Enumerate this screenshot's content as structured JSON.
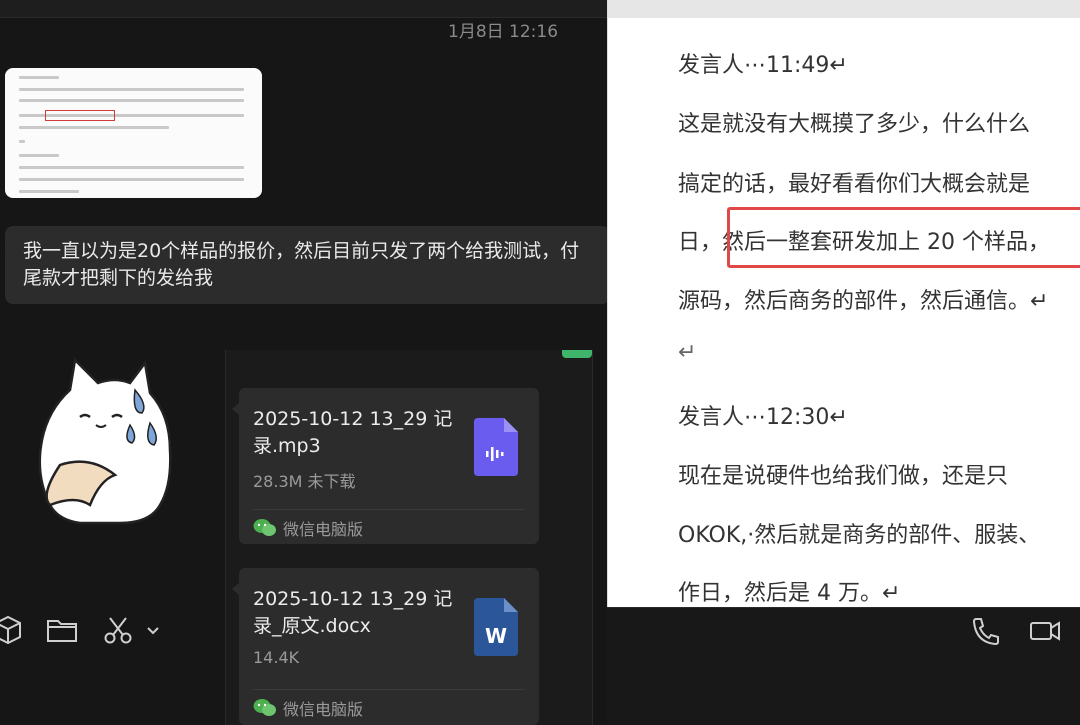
{
  "chat": {
    "timestamp": "1月8日 12:16",
    "message_text_line1": "我一直以为是20个样品的报价，然后目前只发了两个给我测试，付",
    "message_text_line2": "尾款才把剩下的发给我"
  },
  "files": [
    {
      "name": "2025-10-12 13_29 记录.mp3",
      "size_status": "28.3M 未下载",
      "source": "微信电脑版",
      "icon": "audio-file-icon",
      "icon_color": "#6b5cf0"
    },
    {
      "name": "2025-10-12 13_29 记录_原文.docx",
      "size_status": "14.4K",
      "source": "微信电脑版",
      "icon": "word-file-icon",
      "icon_color": "#2b579a"
    }
  ],
  "toolbar": {
    "icons": [
      "cube-icon",
      "folder-icon",
      "scissors-icon",
      "chevron-down-icon",
      "phone-icon",
      "video-icon"
    ]
  },
  "document": {
    "lines": [
      "发言人⋯11:49↵",
      "这是就没有大概摸了多少，什么什么",
      "搞定的话，最好看看你们大概会就是",
      "日，然后一整套研发加上 20 个样品，",
      "源码，然后商务的部件，然后通信。↵",
      "↵",
      "发言人⋯12:30↵",
      "现在是说硬件也给我们做，还是只",
      "OKOK,·然后就是商务的部件、服装、",
      "作日，然后是 4 万。↵"
    ]
  },
  "colors": {
    "highlight": "#e04848",
    "bubble": "#2c2c2c",
    "wechat_green": "#3fb56b"
  }
}
